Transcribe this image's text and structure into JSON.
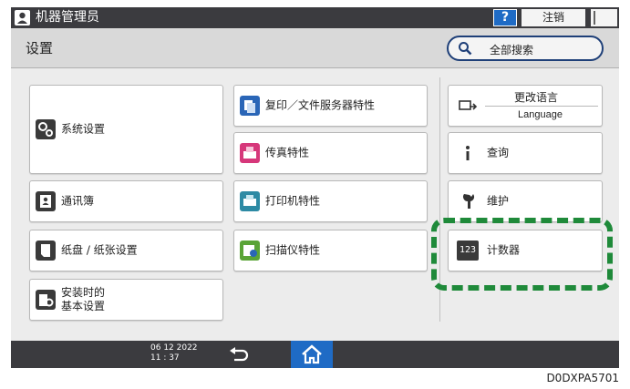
{
  "titlebar": {
    "title": "机器管理员",
    "help_label": "?",
    "logout_label": "注销"
  },
  "header": {
    "title": "设置",
    "search_label": "全部搜索"
  },
  "tiles": {
    "system_settings": "系统设置",
    "copy_docserver": "复印／文件服务器特性",
    "fax": "传真特性",
    "address_book": "通讯簿",
    "printer": "打印机特性",
    "tray_paper": "纸盘 / 纸张设置",
    "scanner": "扫描仪特性",
    "initial_line1": "安装时的",
    "initial_line2": "基本设置",
    "change_language": "更改语言",
    "language": "Language",
    "inquiry": "查询",
    "maintenance": "维护",
    "counter": "计数器",
    "counter_badge": "123"
  },
  "bottombar": {
    "date": "06 12 2022",
    "time": "11 : 37"
  },
  "doc_code": "D0DXPA5701",
  "colors": {
    "bar": "#3b3b3f",
    "accent_blue": "#1f6bc5",
    "highlight_green": "#1f8a3a"
  }
}
